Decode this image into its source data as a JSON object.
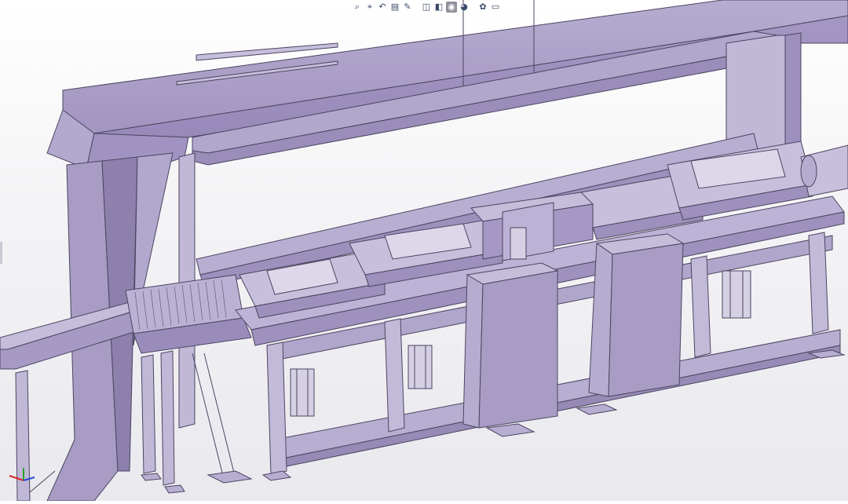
{
  "app": {
    "view": "3D CAD assembly view — gantry conveyor line"
  },
  "toolbar": {
    "buttons": [
      {
        "name": "zoom-to-fit-icon",
        "glyph": "⌕"
      },
      {
        "name": "zoom-area-icon",
        "glyph": "⌖"
      },
      {
        "name": "previous-view-icon",
        "glyph": "↶"
      },
      {
        "name": "section-view-icon",
        "glyph": "▤"
      },
      {
        "name": "dynamic-annotation-icon",
        "glyph": "✎"
      },
      {
        "name": "view-orientation-icon",
        "glyph": "◫"
      },
      {
        "name": "display-style-icon",
        "glyph": "◧"
      },
      {
        "name": "hide-show-items-icon",
        "glyph": "◉"
      },
      {
        "name": "edit-appearance-icon",
        "glyph": "◕"
      },
      {
        "name": "apply-scene-icon",
        "glyph": "✿"
      },
      {
        "name": "view-settings-icon",
        "glyph": "▭"
      }
    ]
  },
  "triad": {
    "x_color": "#d42a2a",
    "y_color": "#2aa02a",
    "z_color": "#2a4ad4"
  },
  "colors": {
    "part_face": "#a89cc4",
    "part_light": "#c9c0dc",
    "part_dark": "#8a7fa8",
    "edge": "#4b4560"
  }
}
